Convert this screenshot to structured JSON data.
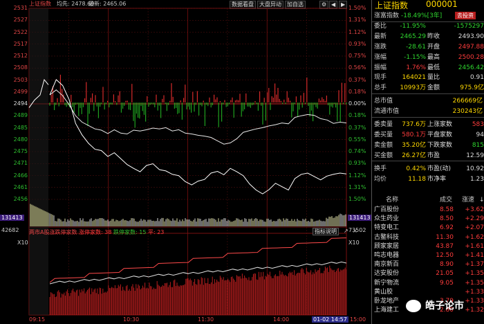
{
  "topbar": {
    "index_name": "上证指数",
    "avg_label": "均先: 2478.69",
    "last_label": "最新: 2465.06",
    "buttons": [
      "数据看盘",
      "大盘异动",
      "加自选"
    ]
  },
  "chart_data": {
    "type": "line",
    "ylim": [
      2456,
      2531
    ],
    "prev_close": 2494,
    "y_ticks_left": [
      "2531",
      "2527",
      "2522",
      "2517",
      "2512",
      "2508",
      "2503",
      "2499",
      "2494",
      "2489",
      "2485",
      "2480",
      "2475",
      "2471",
      "2466",
      "2461",
      "2456"
    ],
    "y_ticks_right": [
      "1.50%",
      "1.31%",
      "1.12%",
      "0.93%",
      "0.75%",
      "0.56%",
      "0.37%",
      "0.18%",
      "0.00%",
      "0.18%",
      "0.37%",
      "0.55%",
      "0.74%",
      "0.93%",
      "1.12%",
      "1.31%",
      "1.50%"
    ],
    "x_ticks": [
      "09:15",
      "10:30",
      "11:30",
      "14:00",
      "15:00"
    ],
    "cursor_time": "01-02 14:57",
    "price_series_approx": [
      2497,
      2503,
      2501,
      2495,
      2486,
      2481,
      2478,
      2476,
      2475,
      2473,
      2474,
      2472,
      2470,
      2468,
      2467,
      2469,
      2470,
      2468,
      2467,
      2466,
      2465,
      2463,
      2462,
      2463,
      2464,
      2466,
      2467,
      2466,
      2468,
      2467,
      2465,
      2462,
      2460,
      2458,
      2460,
      2462,
      2461,
      2460,
      2464,
      2466,
      2466,
      2465,
      2464,
      2465,
      2466,
      2466,
      2466
    ],
    "avg_series_approx": [
      2497,
      2499,
      2497,
      2493,
      2489,
      2486,
      2485,
      2484,
      2483,
      2482,
      2483,
      2482,
      2482,
      2483,
      2483,
      2483,
      2484,
      2484,
      2484,
      2483,
      2483,
      2482,
      2482,
      2481,
      2481,
      2480,
      2479,
      2478,
      2478,
      2480,
      2482,
      2483,
      2484,
      2484,
      2485,
      2485,
      2486,
      2486,
      2488,
      2489,
      2489,
      2489,
      2488,
      2487,
      2486,
      2486,
      2486
    ],
    "volume_badge_top": "131413",
    "volume_badge_right": "131413",
    "volume_mid_left": "42682",
    "volume_mid_right": "73502",
    "volume_unit": "X10",
    "sub_legend": {
      "label": "两市A股涨跌停家数",
      "up_label": "涨停家数: 38",
      "down_label": "跌停家数: 15",
      "flat_label": "平: 23",
      "help": "指标说明"
    }
  },
  "panel": {
    "title": "上证指数",
    "code": "000001",
    "rows": [
      {
        "k": "涨富指数",
        "v": "-18.49%[3年]",
        "v_color": "green",
        "btn": "去投资"
      },
      {
        "k": "委比",
        "v": "-11.95%",
        "k2": "",
        "v2": "-1575297",
        "c1": "green",
        "c2": "green"
      },
      {
        "k": "最新",
        "v": "2465.29",
        "k2": "昨收",
        "v2": "2493.90",
        "c1": "green",
        "c2": "white"
      },
      {
        "k": "涨跌",
        "v": "-28.61",
        "k2": "开盘",
        "v2": "2497.88",
        "c1": "green",
        "c2": "red"
      },
      {
        "k": "涨幅",
        "v": "-1.15%",
        "k2": "最高",
        "v2": "2500.28",
        "c1": "green",
        "c2": "red"
      },
      {
        "k": "振幅",
        "v": "1.76%",
        "k2": "最低",
        "v2": "2456.42",
        "c1": "red",
        "c2": "green"
      },
      {
        "k": "现手",
        "v": "164021",
        "k2": "量比",
        "v2": "0.91",
        "c1": "yellow",
        "c2": "white"
      },
      {
        "k": "总手",
        "v": "10993万",
        "k2": "金额",
        "v2": "975.9亿",
        "c1": "yellow",
        "c2": "yellow"
      },
      {
        "k": "总市值",
        "v": "266669亿",
        "c1": "yellow"
      },
      {
        "k": "流通市值",
        "v": "230243亿",
        "c1": "yellow"
      },
      {
        "k": "委卖量",
        "v": "737.6万",
        "k2": "上涨家数",
        "v2": "583",
        "c1": "yellow",
        "c2": "red"
      },
      {
        "k": "委买量",
        "v": "580.1万",
        "k2": "平盘家数",
        "v2": "94",
        "c1": "red",
        "c2": "white"
      },
      {
        "k": "卖金额",
        "v": "35.20亿",
        "k2": "下跌家数",
        "v2": "815",
        "c1": "yellow",
        "c2": "green"
      },
      {
        "k": "买金额",
        "v": "26.27亿",
        "k2": "市盈",
        "v2": "12.59",
        "c1": "yellow",
        "c2": "white"
      },
      {
        "k": "换手",
        "v": "0.42%",
        "k2": "市盈(动)",
        "v2": "10.92",
        "c1": "yellow",
        "c2": "white"
      },
      {
        "k": "均价",
        "v": "11.18",
        "k2": "市净率",
        "v2": "1.23",
        "c1": "yellow",
        "c2": "white"
      }
    ],
    "list_header": {
      "name": "名称",
      "price": "成交",
      "change": "涨速"
    },
    "list": [
      {
        "name": "广百股份",
        "price": "8.58",
        "change": "+3.62"
      },
      {
        "name": "众生药业",
        "price": "8.50",
        "change": "+2.29"
      },
      {
        "name": "特变电工",
        "price": "6.92",
        "change": "+2.07"
      },
      {
        "name": "古鳌科技",
        "price": "11.30",
        "change": "+1.62"
      },
      {
        "name": "顾家家居",
        "price": "43.87",
        "change": "+1.61"
      },
      {
        "name": "鸣志电器",
        "price": "12.50",
        "change": "+1.41"
      },
      {
        "name": "南京新百",
        "price": "8.90",
        "change": "+1.37"
      },
      {
        "name": "达安股份",
        "price": "21.05",
        "change": "+1.35"
      },
      {
        "name": "新宁物流",
        "price": "9.05",
        "change": "+1.35"
      },
      {
        "name": "黄山胶",
        "price": "",
        "change": "+1.33"
      },
      {
        "name": "卧龙地产",
        "price": "3.79",
        "change": "+1.33"
      },
      {
        "name": "上海建工",
        "price": "2.80",
        "change": "+1.32"
      }
    ]
  },
  "watermark": {
    "text": "皓子论市"
  }
}
